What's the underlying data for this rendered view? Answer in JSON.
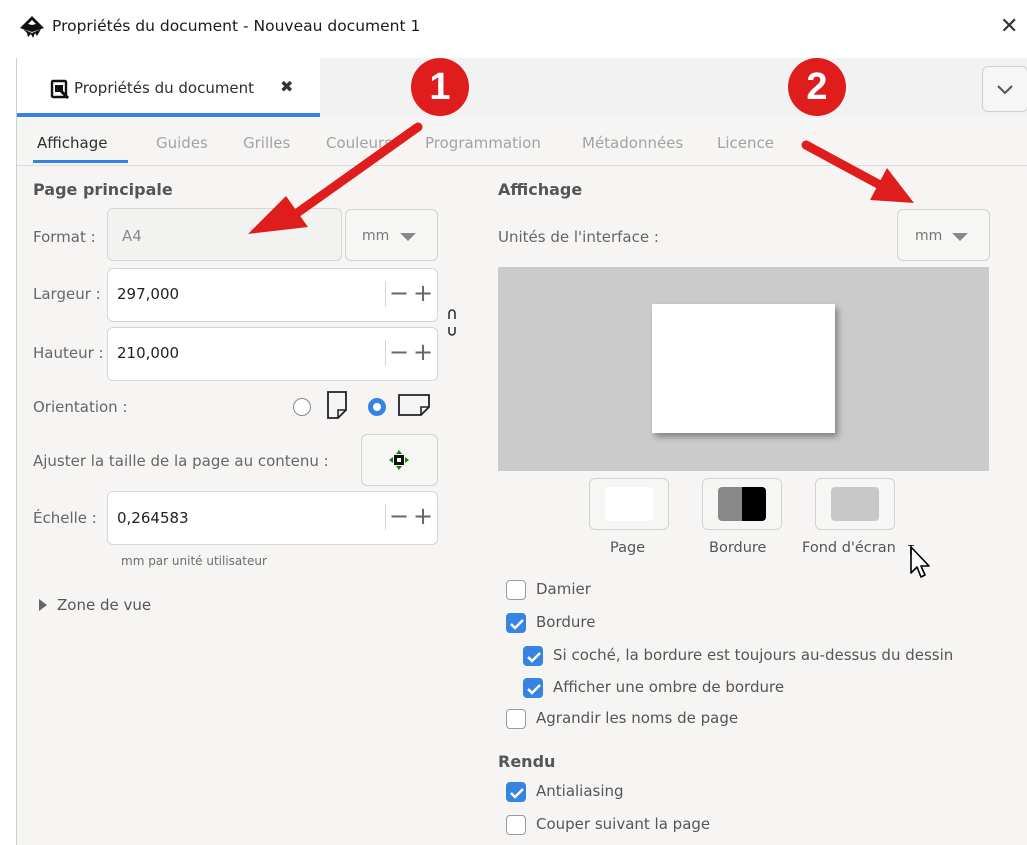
{
  "window": {
    "title": "Propriétés du document - Nouveau document 1",
    "close_glyph": "✕"
  },
  "tab": {
    "label": "Propriétés du document",
    "close_glyph": "✖"
  },
  "subtabs": [
    {
      "label": "Affichage",
      "active": true
    },
    {
      "label": "Guides"
    },
    {
      "label": "Grilles"
    },
    {
      "label": "Couleurs"
    },
    {
      "label": "Programmation"
    },
    {
      "label": "Métadonnées"
    },
    {
      "label": "Licence"
    }
  ],
  "left": {
    "title": "Page principale",
    "format_label": "Format :",
    "format_value": "A4",
    "format_unit": "mm",
    "width_label": "Largeur :",
    "width_value": "297,000",
    "height_label": "Hauteur :",
    "height_value": "210,000",
    "orientation_label": "Orientation :",
    "fit_label": "Ajuster la taille de la page au contenu :",
    "scale_label": "Échelle :",
    "scale_value": "0,264583",
    "scale_note": "mm par unité utilisateur",
    "viewbox_label": "Zone de vue"
  },
  "right": {
    "title": "Affichage",
    "units_label": "Unités de l'interface :",
    "units_value": "mm",
    "swatches": [
      {
        "label": "Page"
      },
      {
        "label": "Bordure"
      },
      {
        "label": "Fond d'écran"
      }
    ],
    "checks": [
      {
        "label": "Damier",
        "checked": false
      },
      {
        "label": "Bordure",
        "checked": true
      },
      {
        "label": "Si coché, la bordure est toujours au-dessus du dessin",
        "checked": true
      },
      {
        "label": "Afficher une ombre de bordure",
        "checked": true
      },
      {
        "label": "Agrandir les noms de page",
        "checked": false
      }
    ],
    "render_title": "Rendu",
    "render_checks": [
      {
        "label": "Antialiasing",
        "checked": true
      },
      {
        "label": "Couper suivant la page",
        "checked": false
      }
    ]
  },
  "callouts": [
    "1",
    "2"
  ],
  "colors": {
    "accent": "#3584e4",
    "callout": "#e01d1d"
  }
}
